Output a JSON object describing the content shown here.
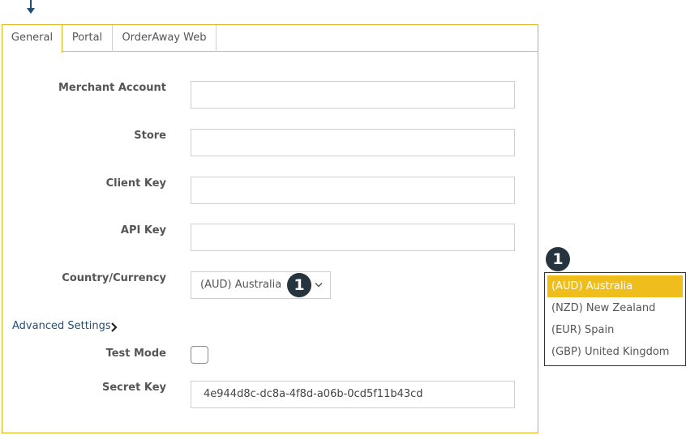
{
  "tabs": [
    "General",
    "Portal",
    "OrderAway Web"
  ],
  "form": {
    "merchant_account_label": "Merchant Account",
    "merchant_account_value": "",
    "store_label": "Store",
    "store_value": "",
    "client_key_label": "Client Key",
    "client_key_value": "",
    "api_key_label": "API Key",
    "api_key_value": "",
    "country_label": "Country/Currency",
    "country_value": "(AUD) Australia",
    "advanced_label": "Advanced Settings",
    "test_mode_label": "Test Mode",
    "test_mode_checked": false,
    "secret_key_label": "Secret Key",
    "secret_key_value": "4e944d8c-dc8a-4f8d-a06b-0cd5f11b43cd"
  },
  "callouts": [
    "1",
    "1"
  ],
  "dropdown": {
    "options": [
      "(AUD) Australia",
      "(NZD) New Zealand",
      "(EUR) Spain",
      "(GBP) United Kingdom"
    ],
    "selected": "(AUD) Australia"
  },
  "colors": {
    "accent": "#efbe1d",
    "panel_border": "#d9b21c",
    "badge": "#263440",
    "link": "#1f4e79",
    "arrow": "#1f4e79"
  },
  "icons": [
    "down-arrow-icon",
    "chevron-down-icon",
    "chevron-right-icon"
  ]
}
